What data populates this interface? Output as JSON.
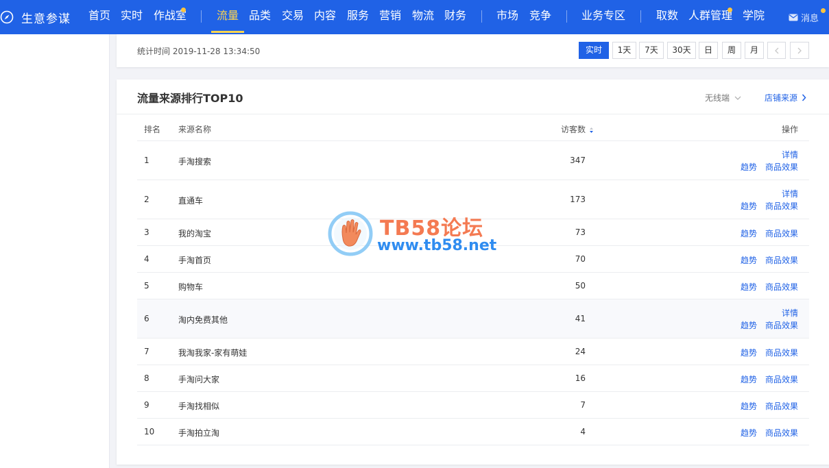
{
  "topnav": {
    "brand": "生意参谋",
    "items": [
      {
        "label": "首页"
      },
      {
        "label": "实时"
      },
      {
        "label": "作战室"
      },
      {
        "label": "流量"
      },
      {
        "label": "品类"
      },
      {
        "label": "交易"
      },
      {
        "label": "内容"
      },
      {
        "label": "服务"
      },
      {
        "label": "营销"
      },
      {
        "label": "物流"
      },
      {
        "label": "财务"
      },
      {
        "label": "市场"
      },
      {
        "label": "竞争"
      },
      {
        "label": "业务专区"
      },
      {
        "label": "取数"
      },
      {
        "label": "人群管理"
      },
      {
        "label": "学院"
      }
    ],
    "active": "流量",
    "message": "消息",
    "colors": {
      "bg": "#2062e6",
      "active": "#ffd54d",
      "dot": "#ffc53d"
    }
  },
  "timebar": {
    "stat_time": "统计时间 2019-11-28 13:34:50",
    "buttons": [
      "实时",
      "1天",
      "7天",
      "30天",
      "日",
      "周",
      "月"
    ],
    "active": "实时"
  },
  "ranking": {
    "title": "流量来源排行TOP10",
    "device": "无线端",
    "shop_source": "店铺来源",
    "columns": {
      "rank": "排名",
      "name": "来源名称",
      "visitors": "访客数",
      "action": "操作"
    },
    "actions": {
      "detail": "详情",
      "trend": "趋势",
      "goods": "商品效果"
    },
    "rows": [
      {
        "rank": "1",
        "name": "手淘搜索",
        "visitors": "347",
        "detail": true
      },
      {
        "rank": "2",
        "name": "直通车",
        "visitors": "173",
        "detail": true
      },
      {
        "rank": "3",
        "name": "我的淘宝",
        "visitors": "73",
        "detail": false
      },
      {
        "rank": "4",
        "name": "手淘首页",
        "visitors": "70",
        "detail": false
      },
      {
        "rank": "5",
        "name": "购物车",
        "visitors": "50",
        "detail": false
      },
      {
        "rank": "6",
        "name": "淘内免费其他",
        "visitors": "41",
        "detail": true
      },
      {
        "rank": "7",
        "name": "我淘我家-家有萌娃",
        "visitors": "24",
        "detail": false
      },
      {
        "rank": "8",
        "name": "手淘问大家",
        "visitors": "16",
        "detail": false
      },
      {
        "rank": "9",
        "name": "手淘找相似",
        "visitors": "7",
        "detail": false
      },
      {
        "rank": "10",
        "name": "手淘拍立淘",
        "visitors": "4",
        "detail": false
      }
    ]
  },
  "watermark": {
    "title": "TB58论坛",
    "url": "www.tb58.net"
  }
}
